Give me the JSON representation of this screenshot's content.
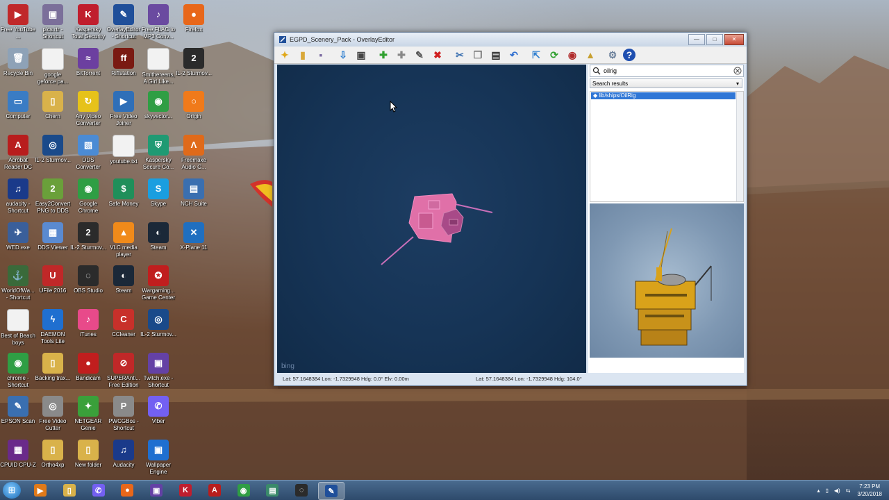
{
  "desktop": {
    "icons": [
      {
        "label": "Free YouTube ...",
        "color": "#c0282a",
        "glyph": "▶"
      },
      {
        "label": "pics.rtr - Shortcut",
        "color": "#7b6f9a",
        "glyph": "▣"
      },
      {
        "label": "Kaspersky Total Security",
        "color": "#c01e2e",
        "glyph": "K"
      },
      {
        "label": "OverlayEditor - Shortcut",
        "color": "#1f4f9a",
        "glyph": "✎"
      },
      {
        "label": "Free FLAC to MP3 Conv...",
        "color": "#6a4aa0",
        "glyph": "♪"
      },
      {
        "label": "Firefox",
        "color": "#e8671a",
        "glyph": "●"
      },
      {
        "label": "Recycle Bin",
        "color": "#8ea2b7",
        "glyph": "🗑"
      },
      {
        "label": "google geforce pa...",
        "color": "#f2f2f2",
        "glyph": ""
      },
      {
        "label": "BitTorrent",
        "color": "#6c3fa0",
        "glyph": "≈"
      },
      {
        "label": "Riffstation",
        "color": "#7a1a12",
        "glyph": "ff"
      },
      {
        "label": "Smithereens, A Girl Like...",
        "color": "#f2f2f2",
        "glyph": ""
      },
      {
        "label": "IL-2 Sturmov...",
        "color": "#2b2b2b",
        "glyph": "2"
      },
      {
        "label": "Computer",
        "color": "#3a7cc4",
        "glyph": "▭"
      },
      {
        "label": "Chern",
        "color": "#d9b24a",
        "glyph": "▯"
      },
      {
        "label": "Any Video Converter",
        "color": "#e6c21a",
        "glyph": "↻"
      },
      {
        "label": "Free Video Joiner",
        "color": "#2f6fb8",
        "glyph": "▶"
      },
      {
        "label": "skyvector...",
        "color": "#2f9e44",
        "glyph": "◉"
      },
      {
        "label": "Origin",
        "color": "#f07a1a",
        "glyph": "○"
      },
      {
        "label": "Acrobat Reader DC",
        "color": "#b81d1d",
        "glyph": "A"
      },
      {
        "label": "IL-2 Sturmov...",
        "color": "#1a4a8a",
        "glyph": "◎"
      },
      {
        "label": "DDS Converter",
        "color": "#4b8bd4",
        "glyph": "▧"
      },
      {
        "label": "youtube.txt",
        "color": "#f2f2f2",
        "glyph": ""
      },
      {
        "label": "Kaspersky Secure Co...",
        "color": "#1f9a73",
        "glyph": "⛨"
      },
      {
        "label": "Freemake Audio C...",
        "color": "#e06a1a",
        "glyph": "Λ"
      },
      {
        "label": "audacity - Shortcut",
        "color": "#1a3a8a",
        "glyph": "♫"
      },
      {
        "label": "Easy2Convert PNG to DDS",
        "color": "#6aa03a",
        "glyph": "2"
      },
      {
        "label": "Google Chrome",
        "color": "#2f9e44",
        "glyph": "◉"
      },
      {
        "label": "Safe Money",
        "color": "#1f8f5a",
        "glyph": "$"
      },
      {
        "label": "Skype",
        "color": "#1a9ee0",
        "glyph": "S"
      },
      {
        "label": "NCH Suite",
        "color": "#3a6fb0",
        "glyph": "▤"
      },
      {
        "label": "WED.exe",
        "color": "#3a5f9a",
        "glyph": "✈"
      },
      {
        "label": "DDS Viewer",
        "color": "#5a8ad0",
        "glyph": "▦"
      },
      {
        "label": "IL-2 Sturmov...",
        "color": "#2b2b2b",
        "glyph": "2"
      },
      {
        "label": "VLC media player",
        "color": "#f08a1a",
        "glyph": "▲"
      },
      {
        "label": "Steam",
        "color": "#1b2838",
        "glyph": "◐"
      },
      {
        "label": "X-Plane 11",
        "color": "#1f6fc0",
        "glyph": "✕"
      },
      {
        "label": "WorldOfWa... - Shortcut",
        "color": "#3a6a3a",
        "glyph": "⚓"
      },
      {
        "label": "UFile 2016",
        "color": "#c02828",
        "glyph": "U"
      },
      {
        "label": "OBS Studio",
        "color": "#2b2b2b",
        "glyph": "◌"
      },
      {
        "label": "Steam",
        "color": "#1b2838",
        "glyph": "◐"
      },
      {
        "label": "Wargaming... Game Center",
        "color": "#c01e1e",
        "glyph": "✪"
      },
      {
        "label": "",
        "color": "transparent",
        "glyph": ""
      },
      {
        "label": "Best of Beach boys",
        "color": "#f2f2f2",
        "glyph": ""
      },
      {
        "label": "DAEMON Tools Lite",
        "color": "#1f6fd0",
        "glyph": "ϟ"
      },
      {
        "label": "iTunes",
        "color": "#e84a8a",
        "glyph": "♪"
      },
      {
        "label": "CCleaner",
        "color": "#c8302a",
        "glyph": "C"
      },
      {
        "label": "IL-2 Sturmov...",
        "color": "#1a4a8a",
        "glyph": "◎"
      },
      {
        "label": "",
        "color": "transparent",
        "glyph": ""
      },
      {
        "label": "chrome - Shortcut",
        "color": "#2f9e44",
        "glyph": "◉"
      },
      {
        "label": "Backing trax...",
        "color": "#d9b24a",
        "glyph": "▯"
      },
      {
        "label": "Bandicam",
        "color": "#c01e1e",
        "glyph": "●"
      },
      {
        "label": "SUPERAnti... Free Edition",
        "color": "#c02828",
        "glyph": "⊘"
      },
      {
        "label": "Twitch.exe - Shortcut",
        "color": "#6441a5",
        "glyph": "▣"
      },
      {
        "label": "",
        "color": "transparent",
        "glyph": ""
      },
      {
        "label": "EPSON Scan",
        "color": "#3a6fb0",
        "glyph": "✎"
      },
      {
        "label": "Free Video Cutter",
        "color": "#8a8a8a",
        "glyph": "◎"
      },
      {
        "label": "NETGEAR Genie",
        "color": "#3aa03a",
        "glyph": "✦"
      },
      {
        "label": "PWCGBos - Shortcut",
        "color": "#8a8a8a",
        "glyph": "P"
      },
      {
        "label": "Viber",
        "color": "#7360f2",
        "glyph": "✆"
      },
      {
        "label": "",
        "color": "transparent",
        "glyph": ""
      },
      {
        "label": "CPUID CPU-Z",
        "color": "#6a2a8a",
        "glyph": "▦"
      },
      {
        "label": "Ortho4xp",
        "color": "#d9b24a",
        "glyph": "▯"
      },
      {
        "label": "New folder",
        "color": "#d9b24a",
        "glyph": "▯"
      },
      {
        "label": "Audacity",
        "color": "#1a3a8a",
        "glyph": "♫"
      },
      {
        "label": "Wallpaper Engine",
        "color": "#1f6fd0",
        "glyph": "▣"
      }
    ]
  },
  "window": {
    "title": "EGPD_Scenery_Pack - OverlayEditor",
    "toolbar_icons": [
      {
        "name": "new-icon",
        "glyph": "✦",
        "color": "#e0a81a"
      },
      {
        "name": "open-icon",
        "glyph": "▮",
        "color": "#d9a83a"
      },
      {
        "name": "save-icon",
        "glyph": "▪",
        "color": "#7a6aa0"
      },
      {
        "name": "import-icon",
        "glyph": "⇩",
        "color": "#2f7fd0"
      },
      {
        "name": "screenshot-icon",
        "glyph": "▣",
        "color": "#444"
      },
      {
        "name": "add-icon",
        "glyph": "✚",
        "color": "#2fa02f"
      },
      {
        "name": "add-node-icon",
        "glyph": "✚",
        "color": "#888"
      },
      {
        "name": "pencil-icon",
        "glyph": "✎",
        "color": "#555"
      },
      {
        "name": "delete-icon",
        "glyph": "✖",
        "color": "#d02020"
      },
      {
        "name": "cut-icon",
        "glyph": "✂",
        "color": "#3a6fb0"
      },
      {
        "name": "copy-icon",
        "glyph": "❐",
        "color": "#777"
      },
      {
        "name": "paste-icon",
        "glyph": "▤",
        "color": "#333"
      },
      {
        "name": "undo-icon",
        "glyph": "↶",
        "color": "#2f6fd0"
      },
      {
        "name": "goto-icon",
        "glyph": "⇱",
        "color": "#2f7fd0"
      },
      {
        "name": "reload-icon",
        "glyph": "⟳",
        "color": "#2fa02f"
      },
      {
        "name": "import-dsf-icon",
        "glyph": "◉",
        "color": "#b02a2a"
      },
      {
        "name": "lock-icon",
        "glyph": "▲",
        "color": "#c8a030"
      },
      {
        "name": "preferences-icon",
        "glyph": "⚙",
        "color": "#6a7f9a"
      },
      {
        "name": "help-icon",
        "glyph": "?",
        "color": "#ffffff"
      }
    ],
    "search": {
      "value": "oilrig",
      "placeholder": ""
    },
    "dropdown": {
      "selected": "Search results"
    },
    "results": [
      "lib/ships/OilRig"
    ],
    "map": {
      "attribution": "bing"
    },
    "status": {
      "left": "Lat: 57.1648384   Lon: -1.7329948   Hdg: 0.0°   Elv: 0.00m",
      "right": "Lat: 57.1648384   Lon: -1.7329948   Hdg: 104.0°"
    },
    "buttons": {
      "minimize": "—",
      "maximize": "□",
      "close": "✕"
    }
  },
  "taskbar": {
    "apps": [
      {
        "name": "media-player",
        "glyph": "▶",
        "color": "#e07a1a"
      },
      {
        "name": "explorer",
        "glyph": "▯",
        "color": "#d9b24a"
      },
      {
        "name": "viber",
        "glyph": "✆",
        "color": "#7360f2"
      },
      {
        "name": "firefox",
        "glyph": "●",
        "color": "#e8671a"
      },
      {
        "name": "twitch",
        "glyph": "▣",
        "color": "#6441a5"
      },
      {
        "name": "kaspersky",
        "glyph": "K",
        "color": "#c01e2e"
      },
      {
        "name": "acrobat",
        "glyph": "A",
        "color": "#b81d1d"
      },
      {
        "name": "chrome",
        "glyph": "◉",
        "color": "#2f9e44"
      },
      {
        "name": "notepad",
        "glyph": "▤",
        "color": "#3a8a6a"
      },
      {
        "name": "obs",
        "glyph": "◌",
        "color": "#2b2b2b"
      },
      {
        "name": "overlayeditor",
        "glyph": "✎",
        "color": "#1f4f9a"
      }
    ],
    "time": "7:23 PM",
    "date": "3/20/2018"
  }
}
